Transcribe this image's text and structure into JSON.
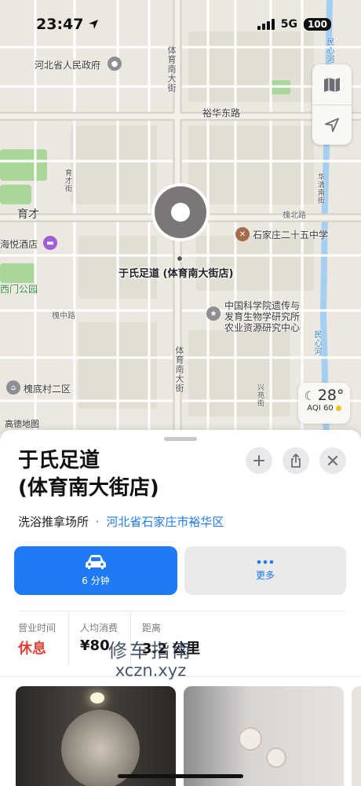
{
  "status_bar": {
    "time": "23:47",
    "network": "5G",
    "battery": "100"
  },
  "map": {
    "labels": {
      "gov": "河北省人民政府",
      "tiyu_north": "体育南大街",
      "yuhua_east": "裕华东路",
      "yucai": "育才",
      "hotel": "海悦酒店",
      "park": "西门公园",
      "yucai_st": "育才街",
      "huaibei": "槐北路",
      "school": "石家庄二十五中学",
      "inst1": "中国科学院遗传与",
      "inst2": "发育生物学研究所",
      "inst3": "农业资源研究中心",
      "huaizhong": "槐中路",
      "tiyu_south": "体育南大街",
      "village": "槐底村二区",
      "xingyuan": "兴苑街",
      "minxin": "民心河",
      "minxin2": "民心河",
      "huaqing": "华清南街",
      "footer": "高德地图"
    },
    "pin_label": "于氏足道 (体育南大街店)",
    "weather": {
      "temp": "28°",
      "aqi": "AQI 60"
    },
    "colors": {
      "road": "#ffffff",
      "major_road": "#d9d3c7",
      "park": "#a9d79a",
      "water": "#a3d0f2",
      "pin": "#7b7776"
    }
  },
  "sheet": {
    "title_line1": "于氏足道",
    "title_line2": "(体育南大街店)",
    "category": "洗浴推拿场所",
    "separator": "·",
    "location": "河北省石家庄市裕华区",
    "drive": {
      "label": "6 分钟",
      "icon": "car-icon"
    },
    "more": {
      "label": "更多",
      "icon": "ellipsis-icon"
    },
    "stats": [
      {
        "label": "营业时间",
        "value": "休息"
      },
      {
        "label": "人均消费",
        "value": "¥80"
      },
      {
        "label": "距离",
        "value": "3.2 公里"
      }
    ]
  },
  "watermark": {
    "line1": "修车指南",
    "line2": "xczn.xyz"
  }
}
